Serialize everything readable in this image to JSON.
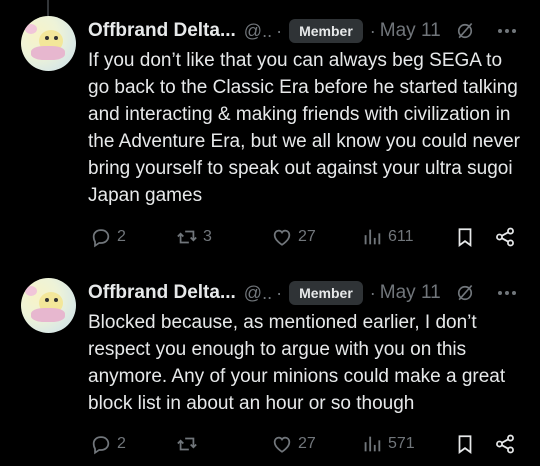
{
  "posts": [
    {
      "display_name": "Offbrand Delta...",
      "handle": "@..",
      "separator": "·",
      "badge": "Member",
      "date": "May 11",
      "text": "If you don’t like that you can always beg SEGA to go back to the Classic Era before he started talking and interacting & making friends with civilization in the Adventure Era, but we all know you could never bring yourself to speak out against your ultra sugoi Japan games",
      "replies": "2",
      "reposts": "3",
      "likes": "27",
      "views": "611"
    },
    {
      "display_name": "Offbrand Delta...",
      "handle": "@..",
      "separator": "·",
      "badge": "Member",
      "date": "May 11",
      "text": "Blocked because, as mentioned earlier, I don’t respect you enough to argue with you on this anymore. Any of your minions could make a great block list in about an hour or so though",
      "replies": "2",
      "reposts": "",
      "likes": "27",
      "views": "571"
    }
  ],
  "icons": {
    "reply": "reply-icon",
    "repost": "repost-icon",
    "like": "heart-icon",
    "views": "views-icon",
    "bookmark": "bookmark-icon",
    "share": "share-icon",
    "grok": "grok-icon",
    "more": "more-icon"
  }
}
